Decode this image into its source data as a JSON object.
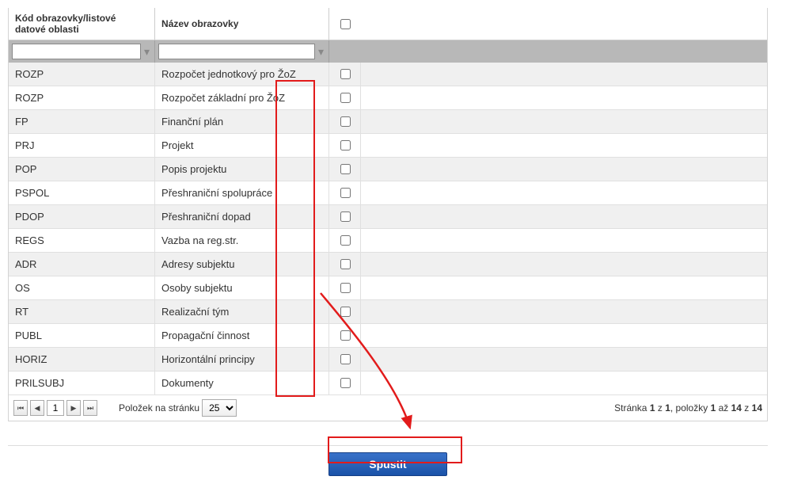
{
  "columns": {
    "code": "Kód obrazovky/listové datové oblasti",
    "name": "Název obrazovky"
  },
  "rows": [
    {
      "code": "ROZP",
      "name": "Rozpočet jednotkový pro ŽoZ"
    },
    {
      "code": "ROZP",
      "name": "Rozpočet základní pro ŽoZ"
    },
    {
      "code": "FP",
      "name": "Finanční plán"
    },
    {
      "code": "PRJ",
      "name": "Projekt"
    },
    {
      "code": "POP",
      "name": "Popis projektu"
    },
    {
      "code": "PSPOL",
      "name": "Přeshraniční spolupráce"
    },
    {
      "code": "PDOP",
      "name": "Přeshraniční dopad"
    },
    {
      "code": "REGS",
      "name": "Vazba na reg.str."
    },
    {
      "code": "ADR",
      "name": "Adresy subjektu"
    },
    {
      "code": "OS",
      "name": "Osoby subjektu"
    },
    {
      "code": "RT",
      "name": "Realizační tým"
    },
    {
      "code": "PUBL",
      "name": "Propagační činnost"
    },
    {
      "code": "HORIZ",
      "name": "Horizontální principy"
    },
    {
      "code": "PRILSUBJ",
      "name": "Dokumenty"
    }
  ],
  "pager": {
    "first": "⏮",
    "prev": "◀",
    "page": "1",
    "next": "▶",
    "last": "⏭",
    "per_page_label": "Položek na stránku",
    "per_page_value": "25",
    "status_prefix": "Stránka ",
    "status_page_cur": "1",
    "status_page_sep": " z ",
    "status_page_tot": "1",
    "status_items_prefix": ", položky ",
    "status_item_from": "1",
    "status_item_mid": " až ",
    "status_item_to": "14",
    "status_item_of": " z ",
    "status_item_tot": "14"
  },
  "run_label": "Spustit",
  "filter": {
    "code_value": "",
    "name_value": ""
  }
}
